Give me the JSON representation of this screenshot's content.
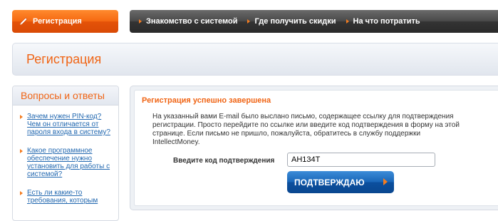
{
  "nav": {
    "register_tab": "Регистрация",
    "items": [
      {
        "label": "Знакомство с системой"
      },
      {
        "label": "Где получить скидки"
      },
      {
        "label": "На что потратить"
      }
    ]
  },
  "page": {
    "title": "Регистрация"
  },
  "faq": {
    "title": "Вопросы и ответы",
    "items": [
      {
        "label": "Зачем нужен PIN-код? Чем он отличается от пароля входа в систему?"
      },
      {
        "label": "Какое программное обеспечение нужно установить для работы с системой?"
      },
      {
        "label": "Есть ли какие-то требования, которым"
      }
    ]
  },
  "main": {
    "success_title": "Регистрация успешно завершена",
    "message": "На указанный вами E-mail было выслано письмо, содержащее ссылку для подтверждения регистрации. Просто перейдите по ссылке или введите код подтверждения в форму на этой странице. Если письмо не пришло, пожалуйста, обратитесь в службу поддержки IntellectMoney.",
    "code_label": "Введите код подтверждения",
    "code_value": "AH134T",
    "confirm_button": "ПОДТВЕРЖДАЮ"
  },
  "colors": {
    "accent": "#f06414",
    "button": "#1a67b9",
    "nav_dark": "#3a3a3a"
  }
}
